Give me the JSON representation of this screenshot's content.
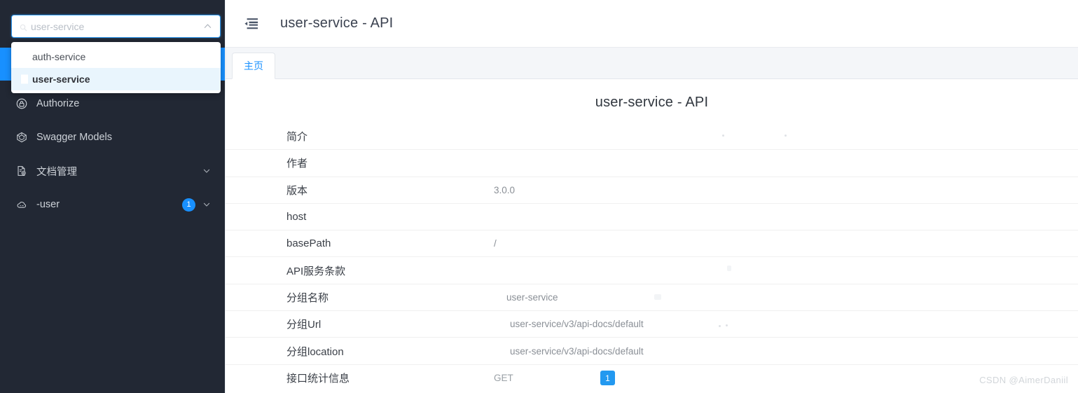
{
  "sidebar": {
    "selector": {
      "value": "user-service",
      "placeholder": "user-service",
      "lead_icon": "search-icon",
      "arrow_icon": "chevron-up-icon"
    },
    "dropdown": {
      "options": [
        {
          "label": "auth-service",
          "selected": false
        },
        {
          "label": "user-service",
          "selected": true
        }
      ]
    },
    "items": [
      {
        "label": "Authorize",
        "icon": "lock-icon",
        "badge": "",
        "chevron": false
      },
      {
        "label": "Swagger Models",
        "icon": "cube-icon",
        "badge": "",
        "chevron": false
      },
      {
        "label": "文档管理",
        "icon": "document-settings-icon",
        "badge": "",
        "chevron": true
      },
      {
        "label": "-user",
        "icon": "cloud-icon",
        "badge": "1",
        "chevron": true
      }
    ],
    "bg_color": "#222834",
    "active_color": "#1890ff"
  },
  "topbar": {
    "fold_icon": "menu-fold-icon",
    "title": "user-service - API"
  },
  "tabs": [
    {
      "label": "主页",
      "active": true
    }
  ],
  "doc": {
    "title": "user-service - API",
    "rows": [
      {
        "key": "简介",
        "value": ""
      },
      {
        "key": "作者",
        "value": ""
      },
      {
        "key": "版本",
        "value": "3.0.0"
      },
      {
        "key": "host",
        "value": ""
      },
      {
        "key": "basePath",
        "value": "/"
      },
      {
        "key": "API服务条款",
        "value": ""
      },
      {
        "key": "分组名称",
        "value": "user-service"
      },
      {
        "key": "分组Url",
        "value": "user-service/v3/api-docs/default"
      },
      {
        "key": "分组location",
        "value": "user-service/v3/api-docs/default"
      }
    ],
    "stats_row": {
      "key": "接口统计信息",
      "method": "GET",
      "count": "1",
      "badge_color": "#2399f0"
    }
  },
  "watermark": "CSDN @AimerDaniil"
}
